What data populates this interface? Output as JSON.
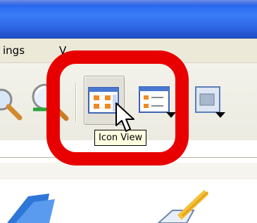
{
  "menu": {
    "settings_fragment": "ings",
    "second_fragment": "V"
  },
  "toolbar": {
    "search_icon": "magnifier-icon",
    "zoom_icon": "zoom-magnifier-icon",
    "icon_view_icon": "icon-view-icon",
    "list_view_icon": "list-view-icon",
    "preview_icon": "image-preview-icon",
    "active_button": "icon-view"
  },
  "tooltip": {
    "text": "Icon View"
  },
  "colors": {
    "titlebar": "#2c6cf0",
    "highlight": "#e80000",
    "tooltip_bg": "#ffffe1",
    "menubar": "#ece9d8"
  }
}
